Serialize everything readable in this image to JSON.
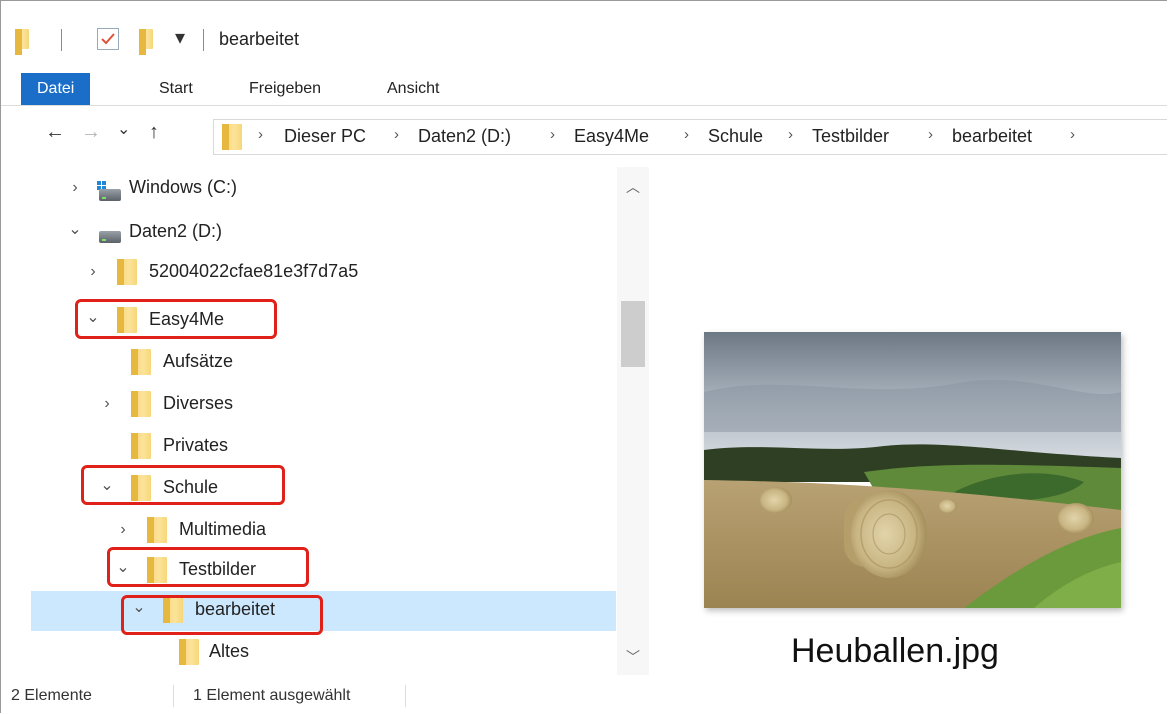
{
  "window": {
    "title": "bearbeitet",
    "quick_access_dropdown": "▾"
  },
  "ribbon": {
    "tabs": [
      "Datei",
      "Start",
      "Freigeben",
      "Ansicht"
    ]
  },
  "nav": {
    "back": "←",
    "forward": "→",
    "recent": "⌄",
    "up": "↑",
    "breadcrumb": [
      "Dieser PC",
      "Daten2 (D:)",
      "Easy4Me",
      "Schule",
      "Testbilder",
      "bearbeitet"
    ]
  },
  "tree": {
    "items": [
      {
        "label": "Windows (C:)",
        "icon": "system-drive-icon",
        "expander": "collapsed"
      },
      {
        "label": "Daten2 (D:)",
        "icon": "drive-icon",
        "expander": "expanded"
      },
      {
        "label": "52004022cfae81e3f7d7a5",
        "icon": "folder-icon",
        "expander": "collapsed"
      },
      {
        "label": "Easy4Me",
        "icon": "folder-icon",
        "expander": "expanded",
        "highlighted": true
      },
      {
        "label": "Aufsätze",
        "icon": "folder-icon",
        "expander": "none"
      },
      {
        "label": "Diverses",
        "icon": "folder-icon",
        "expander": "collapsed"
      },
      {
        "label": "Privates",
        "icon": "folder-icon",
        "expander": "none"
      },
      {
        "label": "Schule",
        "icon": "folder-icon",
        "expander": "expanded",
        "highlighted": true
      },
      {
        "label": "Multimedia",
        "icon": "folder-icon",
        "expander": "collapsed"
      },
      {
        "label": "Testbilder",
        "icon": "folder-icon",
        "expander": "expanded",
        "highlighted": true
      },
      {
        "label": "bearbeitet",
        "icon": "folder-icon",
        "expander": "expanded",
        "highlighted": true,
        "selected": true
      },
      {
        "label": "Altes",
        "icon": "folder-icon",
        "expander": "none"
      }
    ]
  },
  "preview": {
    "file_name": "Heuballen.jpg"
  },
  "status": {
    "item_count": "2 Elemente",
    "selection": "1 Element ausgewählt"
  },
  "colors": {
    "accent": "#1a6ec7",
    "selection": "#cce8ff",
    "highlight_border": "#e0211a"
  }
}
